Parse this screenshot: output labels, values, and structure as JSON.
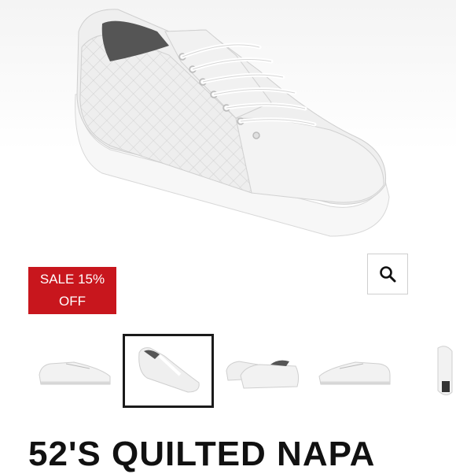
{
  "hero": {
    "image_alt": "White quilted leather sneaker"
  },
  "sale_badge": {
    "line1": "SALE 15%",
    "line2": "OFF",
    "color": "#c8161d"
  },
  "zoom_button": {
    "icon": "search-icon"
  },
  "thumbnails": [
    {
      "alt": "Side view",
      "selected": false
    },
    {
      "alt": "Three-quarter view",
      "selected": true
    },
    {
      "alt": "Pair front view",
      "selected": false
    },
    {
      "alt": "Side view right",
      "selected": false
    },
    {
      "alt": "Sole view",
      "selected": false
    }
  ],
  "product": {
    "title": "52'S QUILTED NAPA"
  }
}
